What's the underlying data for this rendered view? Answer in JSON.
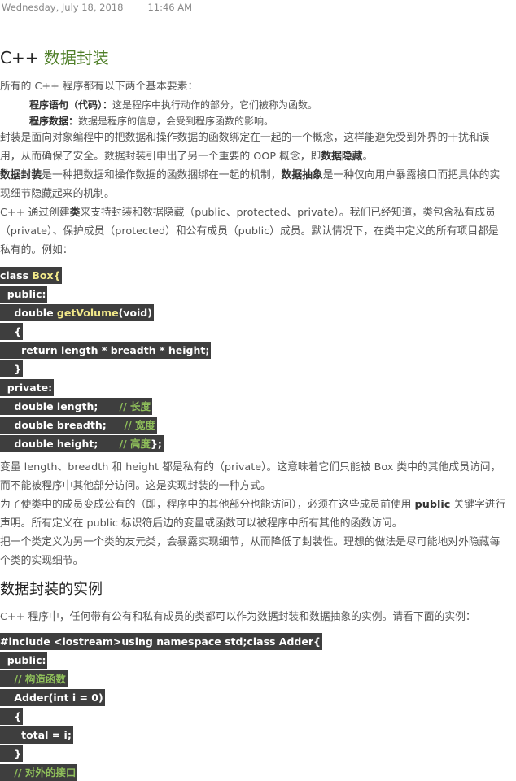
{
  "meta": {
    "date": "Wednesday, July 18, 2018",
    "time": "11:46 AM"
  },
  "title": {
    "prefix": "C++ ",
    "accent": "数据封装"
  },
  "intro": "所有的 C++ 程序都有以下两个基本要素：",
  "items": [
    {
      "term": "程序语句（代码）：",
      "desc": "这是程序中执行动作的部分，它们被称为函数。"
    },
    {
      "term": "程序数据：",
      "desc": "数据是程序的信息，会受到程序函数的影响。"
    }
  ],
  "p1": {
    "text": "封装是面向对象编程中的把数据和操作数据的函数绑定在一起的一个概念，这样能避免受到外界的干扰和误用，从而确保了安全。数据封装引申出了另一个重要的 OOP 概念，即",
    "bold": "数据隐藏",
    "end": "。"
  },
  "p2": {
    "b1": "数据封装",
    "t1": "是一种把数据和操作数据的函数捆绑在一起的机制，",
    "b2": "数据抽象",
    "t2": "是一种仅向用户暴露接口而把具体的实现细节隐藏起来的机制。"
  },
  "p3": {
    "t1": "C++ 通过创建",
    "b1": "类",
    "t2": "来支持封装和数据隐藏（public、protected、private）。我们已经知道，类包含私有成员（private）、保护成员（protected）和公有成员（public）成员。默认情况下，在类中定义的所有项目都是私有的。例如："
  },
  "code1": {
    "l1a": "class ",
    "l1b": "Box",
    "l1c": "{",
    "l2": "  public:",
    "l3a": "    double ",
    "l3b": "getVolume",
    "l3c": "(void)",
    "l4": "    {",
    "l5": "      return length * breadth * height;",
    "l6": "    }",
    "l7": "  private:",
    "l8a": "    double length;      ",
    "l8b": "// 长度",
    "l9a": "    double breadth;     ",
    "l9b": "// 宽度",
    "l10a": "    double height;      ",
    "l10b": "// 高度",
    "l10c": "};"
  },
  "p4": "变量 length、breadth 和 height 都是私有的（private）。这意味着它们只能被 Box 类中的其他成员访问，而不能被程序中其他部分访问。这是实现封装的一种方式。",
  "p5": {
    "t1": "为了使类中的成员变成公有的（即，程序中的其他部分也能访问），必须在这些成员前使用 ",
    "b1": "public",
    "t2": " 关键字进行声明。所有定义在 public 标识符后边的变量或函数可以被程序中所有其他的函数访问。"
  },
  "p6": "把一个类定义为另一个类的友元类，会暴露实现细节，从而降低了封装性。理想的做法是尽可能地对外隐藏每个类的实现细节。",
  "h2": "数据封装的实例",
  "p7": "C++ 程序中，任何带有公有和私有成员的类都可以作为数据封装和数据抽象的实例。请看下面的实例：",
  "code2": {
    "l1": "#include <iostream>using namespace std;class Adder{",
    "l2": "  public:",
    "l3": "    // 构造函数",
    "l4": "    Adder(int i = 0)",
    "l5": "    {",
    "l6": "      total = i;",
    "l7": "    }",
    "l8": "    // 对外的接口"
  }
}
